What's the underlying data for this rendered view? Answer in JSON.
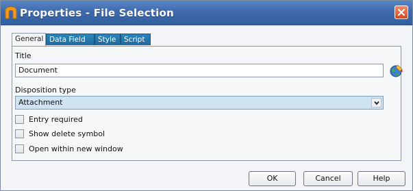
{
  "window": {
    "title": "Properties - File Selection",
    "title_bar_color": "#3e6aad",
    "close_color": "#d44a24"
  },
  "tabs": [
    {
      "label": "General",
      "active": true
    },
    {
      "label": "Data Field",
      "active": false
    },
    {
      "label": "Style",
      "active": false
    },
    {
      "label": "Script",
      "active": false
    }
  ],
  "form": {
    "title_label": "Title",
    "title_value": "Document",
    "disposition_label": "Disposition type",
    "disposition_value": "Attachment",
    "disposition_highlight": "#cfe3f1"
  },
  "checkboxes": [
    {
      "label": "Entry required",
      "checked": false
    },
    {
      "label": "Show delete symbol",
      "checked": false
    },
    {
      "label": "Open within new window",
      "checked": false
    }
  ],
  "buttons": {
    "ok": "OK",
    "cancel": "Cancel",
    "help": "Help"
  },
  "icons": {
    "app": "app-arch-icon",
    "close": "close-icon",
    "globe": "globe-edit-icon",
    "dropdown": "chevron-down-icon"
  }
}
